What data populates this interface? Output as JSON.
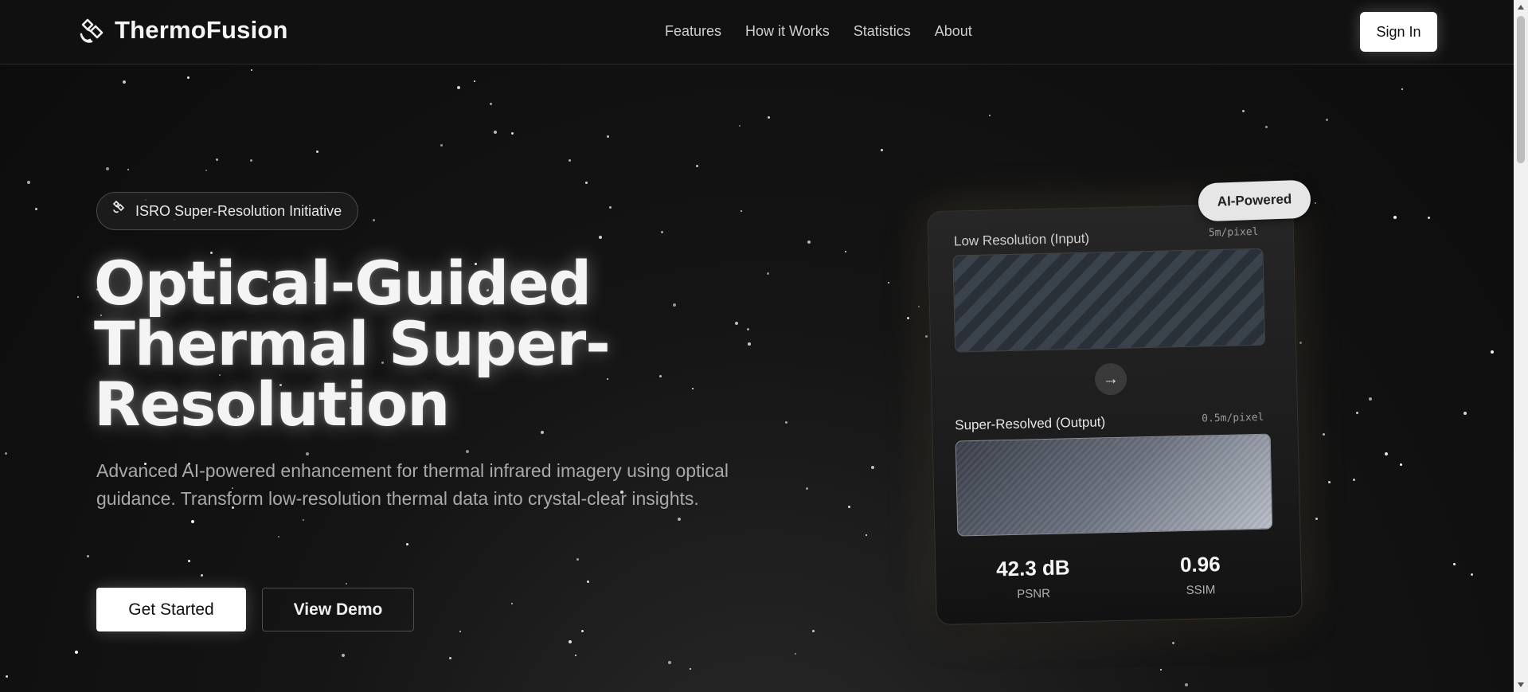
{
  "brand": {
    "name": "ThermoFusion"
  },
  "nav": {
    "links": [
      "Features",
      "How it Works",
      "Statistics",
      "About"
    ],
    "signin": "Sign In"
  },
  "hero": {
    "badge": "ISRO Super-Resolution Initiative",
    "title_lines": [
      "Optical-Guided",
      "Thermal Super-",
      "Resolution"
    ],
    "description": "Advanced AI-powered enhancement for thermal infrared imagery using optical guidance. Transform low-resolution thermal data into crystal-clear insights.",
    "primary_button": "Get Started",
    "secondary_button": "View Demo"
  },
  "card": {
    "pill": "AI-Powered",
    "low_label": "Low Resolution (Input)",
    "low_res": "5m/pixel",
    "high_label": "Super-Resolved (Output)",
    "high_res": "0.5m/pixel",
    "metrics": [
      {
        "value": "42.3 dB",
        "label": "PSNR"
      },
      {
        "value": "0.96",
        "label": "SSIM"
      }
    ]
  },
  "colors": {
    "background": "#121212",
    "accent": "#ffffff",
    "muted_text": "#a9a9a9"
  }
}
